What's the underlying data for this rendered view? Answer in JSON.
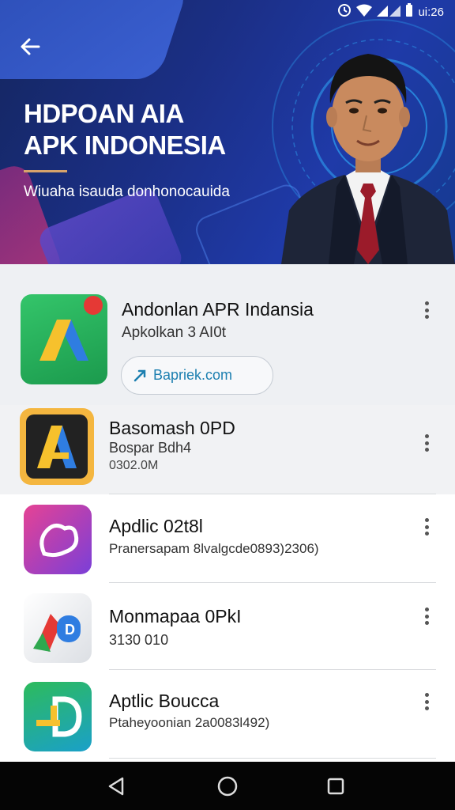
{
  "status_bar": {
    "time": "ui:26"
  },
  "hero": {
    "title_line1": "HDPOAN AIA",
    "title_line2": "APK INDONESIA",
    "subtitle": "Wiuaha isauda donhonocauida"
  },
  "featured": {
    "name": "Andonlan APR Indansia",
    "meta": "Apkolkan 3 AI0t",
    "link": "Bapriek.com"
  },
  "apps": [
    {
      "name": "Basomash 0PD",
      "meta1": "Bospar Bdh4",
      "meta2": "0302.0M"
    },
    {
      "name": "Apdlic 02t8l",
      "meta1": "Pranersapam 8lvalgcde0893)2306)"
    },
    {
      "name": "Monmapaa 0PkI",
      "meta1": "3130 010"
    },
    {
      "name": "Aptlic Boucca",
      "meta1": "Ptaheyoonian 2a0083l492)"
    }
  ],
  "colors": {
    "accent": "#1c7fb0",
    "hero_bg": "#1b2f86",
    "badge": "#e53935"
  }
}
